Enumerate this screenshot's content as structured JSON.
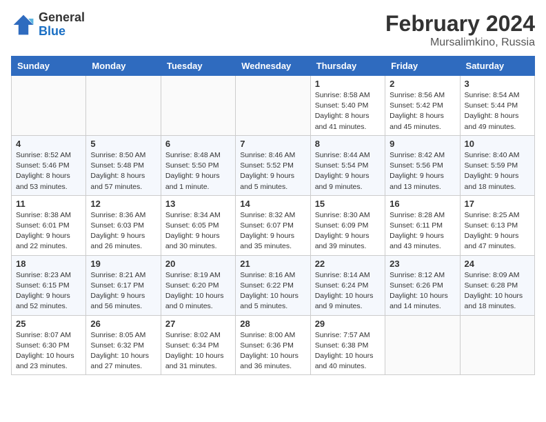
{
  "logo": {
    "general": "General",
    "blue": "Blue"
  },
  "title": "February 2024",
  "subtitle": "Mursalimkino, Russia",
  "days_of_week": [
    "Sunday",
    "Monday",
    "Tuesday",
    "Wednesday",
    "Thursday",
    "Friday",
    "Saturday"
  ],
  "weeks": [
    [
      {
        "day": "",
        "info": ""
      },
      {
        "day": "",
        "info": ""
      },
      {
        "day": "",
        "info": ""
      },
      {
        "day": "",
        "info": ""
      },
      {
        "day": "1",
        "info": "Sunrise: 8:58 AM\nSunset: 5:40 PM\nDaylight: 8 hours\nand 41 minutes."
      },
      {
        "day": "2",
        "info": "Sunrise: 8:56 AM\nSunset: 5:42 PM\nDaylight: 8 hours\nand 45 minutes."
      },
      {
        "day": "3",
        "info": "Sunrise: 8:54 AM\nSunset: 5:44 PM\nDaylight: 8 hours\nand 49 minutes."
      }
    ],
    [
      {
        "day": "4",
        "info": "Sunrise: 8:52 AM\nSunset: 5:46 PM\nDaylight: 8 hours\nand 53 minutes."
      },
      {
        "day": "5",
        "info": "Sunrise: 8:50 AM\nSunset: 5:48 PM\nDaylight: 8 hours\nand 57 minutes."
      },
      {
        "day": "6",
        "info": "Sunrise: 8:48 AM\nSunset: 5:50 PM\nDaylight: 9 hours\nand 1 minute."
      },
      {
        "day": "7",
        "info": "Sunrise: 8:46 AM\nSunset: 5:52 PM\nDaylight: 9 hours\nand 5 minutes."
      },
      {
        "day": "8",
        "info": "Sunrise: 8:44 AM\nSunset: 5:54 PM\nDaylight: 9 hours\nand 9 minutes."
      },
      {
        "day": "9",
        "info": "Sunrise: 8:42 AM\nSunset: 5:56 PM\nDaylight: 9 hours\nand 13 minutes."
      },
      {
        "day": "10",
        "info": "Sunrise: 8:40 AM\nSunset: 5:59 PM\nDaylight: 9 hours\nand 18 minutes."
      }
    ],
    [
      {
        "day": "11",
        "info": "Sunrise: 8:38 AM\nSunset: 6:01 PM\nDaylight: 9 hours\nand 22 minutes."
      },
      {
        "day": "12",
        "info": "Sunrise: 8:36 AM\nSunset: 6:03 PM\nDaylight: 9 hours\nand 26 minutes."
      },
      {
        "day": "13",
        "info": "Sunrise: 8:34 AM\nSunset: 6:05 PM\nDaylight: 9 hours\nand 30 minutes."
      },
      {
        "day": "14",
        "info": "Sunrise: 8:32 AM\nSunset: 6:07 PM\nDaylight: 9 hours\nand 35 minutes."
      },
      {
        "day": "15",
        "info": "Sunrise: 8:30 AM\nSunset: 6:09 PM\nDaylight: 9 hours\nand 39 minutes."
      },
      {
        "day": "16",
        "info": "Sunrise: 8:28 AM\nSunset: 6:11 PM\nDaylight: 9 hours\nand 43 minutes."
      },
      {
        "day": "17",
        "info": "Sunrise: 8:25 AM\nSunset: 6:13 PM\nDaylight: 9 hours\nand 47 minutes."
      }
    ],
    [
      {
        "day": "18",
        "info": "Sunrise: 8:23 AM\nSunset: 6:15 PM\nDaylight: 9 hours\nand 52 minutes."
      },
      {
        "day": "19",
        "info": "Sunrise: 8:21 AM\nSunset: 6:17 PM\nDaylight: 9 hours\nand 56 minutes."
      },
      {
        "day": "20",
        "info": "Sunrise: 8:19 AM\nSunset: 6:20 PM\nDaylight: 10 hours\nand 0 minutes."
      },
      {
        "day": "21",
        "info": "Sunrise: 8:16 AM\nSunset: 6:22 PM\nDaylight: 10 hours\nand 5 minutes."
      },
      {
        "day": "22",
        "info": "Sunrise: 8:14 AM\nSunset: 6:24 PM\nDaylight: 10 hours\nand 9 minutes."
      },
      {
        "day": "23",
        "info": "Sunrise: 8:12 AM\nSunset: 6:26 PM\nDaylight: 10 hours\nand 14 minutes."
      },
      {
        "day": "24",
        "info": "Sunrise: 8:09 AM\nSunset: 6:28 PM\nDaylight: 10 hours\nand 18 minutes."
      }
    ],
    [
      {
        "day": "25",
        "info": "Sunrise: 8:07 AM\nSunset: 6:30 PM\nDaylight: 10 hours\nand 23 minutes."
      },
      {
        "day": "26",
        "info": "Sunrise: 8:05 AM\nSunset: 6:32 PM\nDaylight: 10 hours\nand 27 minutes."
      },
      {
        "day": "27",
        "info": "Sunrise: 8:02 AM\nSunset: 6:34 PM\nDaylight: 10 hours\nand 31 minutes."
      },
      {
        "day": "28",
        "info": "Sunrise: 8:00 AM\nSunset: 6:36 PM\nDaylight: 10 hours\nand 36 minutes."
      },
      {
        "day": "29",
        "info": "Sunrise: 7:57 AM\nSunset: 6:38 PM\nDaylight: 10 hours\nand 40 minutes."
      },
      {
        "day": "",
        "info": ""
      },
      {
        "day": "",
        "info": ""
      }
    ]
  ]
}
